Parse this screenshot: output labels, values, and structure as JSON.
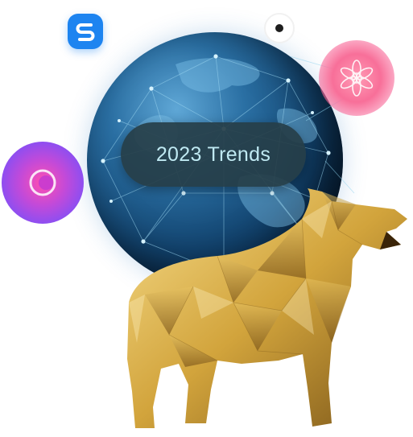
{
  "banner": {
    "label": "2023 Trends"
  },
  "icons": {
    "app_badge": "s-logo-icon",
    "dot_icon": "dot-ring-icon",
    "flower_icon": "flower-icon",
    "orb_icon": "gradient-orb-icon",
    "figure": "golden-bear-sculpture"
  },
  "colors": {
    "globe": "#12436e",
    "badge_blue": "#1d84f0",
    "pill_text": "#bfe9f2",
    "pink": "#f86f99",
    "purple": "#8f4ef0",
    "gold": "#d2a43c"
  }
}
